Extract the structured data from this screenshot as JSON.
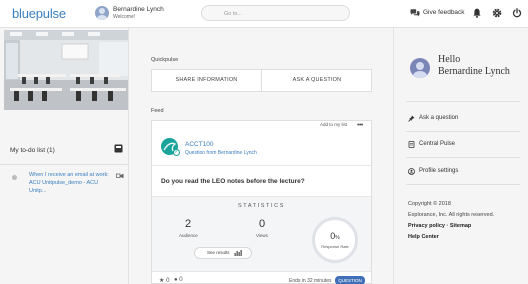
{
  "header": {
    "logo": "bluepulse",
    "user_name": "Bernardine Lynch",
    "user_subtitle": "Welcome!",
    "search_placeholder": "Go to...",
    "feedback_label": "Give feedback"
  },
  "sidebar_left": {
    "todo_title": "My to-do list (1)",
    "todo_items": [
      {
        "text": "When I receive an email at work: ACU Unitpulse_demo - ACU Unitp..."
      }
    ]
  },
  "main": {
    "quickpulse_label": "Quickpulse",
    "share_label": "SHARE INFORMATION",
    "ask_label": "ASK A QUESTION",
    "feed_label": "Feed",
    "card": {
      "add_to_list": "Add to my list",
      "more": "•••",
      "course": "ACCT100",
      "course_subtitle": "Question from Bernardine Lynch",
      "question": "Do you read the LEO notes before the lecture?",
      "statistics_title": "STATISTICS",
      "audience_value": "2",
      "audience_label": "Audience",
      "views_value": "0",
      "views_label": "Views",
      "see_results": "See results",
      "response_rate_value": "0",
      "response_rate_unit": "%",
      "response_rate_label": "Response Rate",
      "response_rate_fraction": 0,
      "stars_count": "0",
      "comments_count": "0",
      "ends_text": "Ends in 32 minutes",
      "badge": "QUESTION"
    }
  },
  "sidebar_right": {
    "greeting": "Hello",
    "name": "Bernardine Lynch",
    "links": [
      {
        "label": "Ask a question",
        "icon": "pin-icon"
      },
      {
        "label": "Central Pulse",
        "icon": "document-icon"
      },
      {
        "label": "Profile settings",
        "icon": "user-circle-icon"
      }
    ],
    "copyright": "Copyright © 2018",
    "company": "Explorance, Inc. All rights reserved.",
    "privacy": "Privacy policy · Sitemap",
    "help": "Help Center"
  },
  "colors": {
    "brand_blue": "#3a7fbf",
    "teal": "#1aa39a",
    "badge_blue": "#3f6fb8"
  }
}
